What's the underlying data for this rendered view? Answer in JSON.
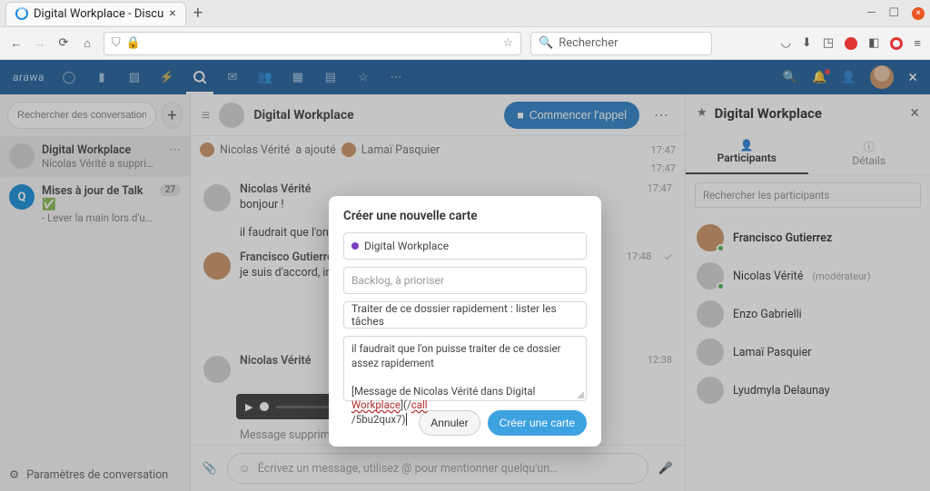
{
  "browser": {
    "tab_title": "Digital Workplace - Discu",
    "search_placeholder": "Rechercher"
  },
  "app": {
    "logo": "arawa"
  },
  "left": {
    "search_placeholder": "Rechercher des conversations ou de",
    "convos": [
      {
        "title": "Digital Workplace",
        "subtitle": "Nicolas Vérité a supprimé u..."
      },
      {
        "title": "Mises à jour de Talk ✅",
        "subtitle": "- Lever la main lors d'u...",
        "count": "27"
      }
    ],
    "footer": "Paramètres de conversation"
  },
  "chat": {
    "title": "Digital Workplace",
    "start_call": "Commencer l'appel",
    "sys_person1": "Nicolas Vérité",
    "sys_action": "a ajouté",
    "sys_person2": "Lamaï Pasquier",
    "sys_time": "17:47",
    "msgs": [
      {
        "author": "Nicolas Vérité",
        "lines": [
          "bonjour !",
          "il faudrait que l'on puis"
        ],
        "time": "17:47"
      },
      {
        "author": "Francisco Gutierrez",
        "lines": [
          "je suis d'accord, investi"
        ],
        "time": "17:48",
        "check": true
      },
      {
        "author": "Nicolas Vérité",
        "lines": [],
        "time": "12:38"
      }
    ],
    "deleted": "Message supprimé par l'auteur",
    "compose_placeholder": "Écrivez un message, utilisez @ pour mentionner quelqu'un…"
  },
  "right": {
    "title": "Digital Workplace",
    "tab_participants": "Participants",
    "tab_details": "Détails",
    "search_placeholder": "Rechercher les participants",
    "participants": [
      {
        "name": "Francisco Gutierrez",
        "online": true
      },
      {
        "name": "Nicolas Vérité",
        "mod": "(modérateur)",
        "online": true
      },
      {
        "name": "Enzo Gabrielli"
      },
      {
        "name": "Lamaï Pasquier"
      },
      {
        "name": "Lyudmyla Delaunay"
      }
    ]
  },
  "modal": {
    "title": "Créer une nouvelle carte",
    "board": "Digital Workplace",
    "list_placeholder": "Backlog, à prioriser",
    "card_title": "Traiter de ce dossier rapidement : lister les tâches",
    "desc_line1": "il faudrait que l'on puisse traiter de ce dossier assez rapidement",
    "desc_line2a": "[Message de Nicolas Vérité dans Digital ",
    "desc_hl1": "Workplace",
    "desc_line2b": "](/",
    "desc_hl2": "call",
    "desc_line3": "/5bu2qux7)",
    "cancel": "Annuler",
    "create": "Créer une carte"
  }
}
